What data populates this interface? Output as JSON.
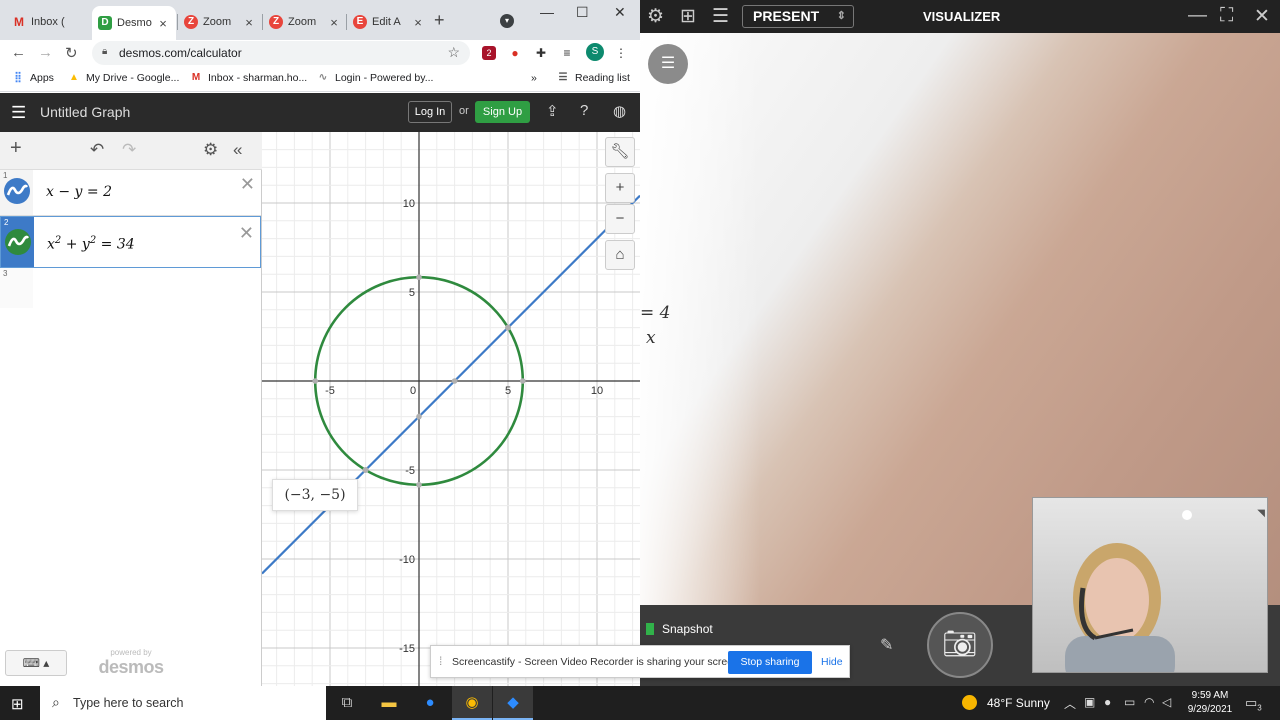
{
  "browser": {
    "tabs": [
      {
        "label": "Inbox (",
        "icon": "M",
        "color": "#d93025"
      },
      {
        "label": "Desmo",
        "icon": "D",
        "color": "#2f9e43"
      },
      {
        "label": "Zoom",
        "icon": "Z",
        "color": "#e8453c"
      },
      {
        "label": "Zoom",
        "icon": "Z",
        "color": "#e8453c"
      },
      {
        "label": "Edit A",
        "icon": "E",
        "color": "#e8453c"
      }
    ],
    "tab_close": "×",
    "new_tab": "+",
    "url": "desmos.com/calculator",
    "profile_initial": "S",
    "ext_badge": "2",
    "bookmarks": [
      {
        "label": "Apps"
      },
      {
        "label": "My Drive - Google..."
      },
      {
        "label": "Inbox - sharman.ho..."
      },
      {
        "label": "Login - Powered by..."
      }
    ],
    "bookmarks_more": "»",
    "reading_list": "Reading list"
  },
  "desmos": {
    "title": "Untitled Graph",
    "login": "Log In",
    "or": "or",
    "signup": "Sign Up",
    "expressions": [
      {
        "num": "1",
        "latex": "x − y = 2",
        "color": "#3d7ac7"
      },
      {
        "num": "2",
        "latex_base1": "x",
        "latex_exp1": "2",
        "latex_mid": " + y",
        "latex_exp2": "2",
        "latex_end": " = 34",
        "color": "#2f8a3e"
      },
      {
        "num": "3"
      }
    ],
    "powered_by": "powered by",
    "brand": "desmos",
    "tooltip": "(−3, −5)"
  },
  "graph": {
    "x_ticks": [
      "-5",
      "0",
      "5",
      "10"
    ],
    "y_ticks": [
      "10",
      "5",
      "-5",
      "-10",
      "-15"
    ],
    "series": [
      {
        "type": "line",
        "equation": "x - y = 2",
        "color": "#3d7ac7"
      },
      {
        "type": "circle",
        "equation": "x^2 + y^2 = 34",
        "radius_squared": 34,
        "color": "#2f8a3e"
      }
    ],
    "intersections": [
      [
        -3,
        -5
      ],
      [
        5,
        3
      ]
    ],
    "point_color": "#b0b0b0"
  },
  "visualizer": {
    "present": "PRESENT",
    "title": "VISUALIZER",
    "paper_line1": "= 4",
    "paper_line2": "x",
    "snapshot": "Snapshot"
  },
  "share": {
    "message": "Screencastify - Screen Video Recorder is sharing your screen.",
    "stop": "Stop sharing",
    "hide": "Hide"
  },
  "taskbar": {
    "search_placeholder": "Type here to search",
    "weather": "48°F  Sunny",
    "time": "9:59 AM",
    "date": "9/29/2021",
    "notif_count": "3"
  }
}
